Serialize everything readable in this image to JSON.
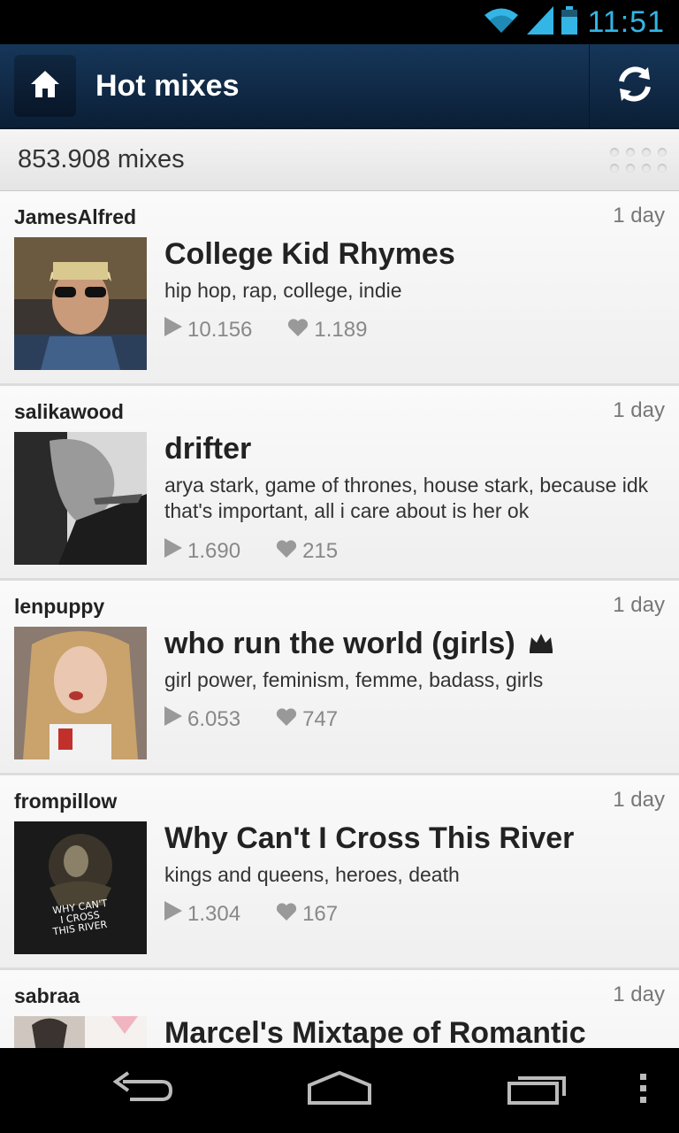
{
  "status_bar": {
    "time": "11:51",
    "icons": [
      "wifi-icon",
      "signal-icon",
      "battery-icon"
    ],
    "accent": "#33b5e5"
  },
  "action_bar": {
    "title": "Hot mixes",
    "home_icon": "home-icon",
    "refresh_icon": "refresh-icon",
    "bg_color": "#163659"
  },
  "count_bar": {
    "count_label": "853.908 mixes"
  },
  "mixes": [
    {
      "user": "JamesAlfred",
      "age": "1 day",
      "title": "College Kid Rhymes",
      "tags": "hip hop, rap, college, indie",
      "plays": "10.156",
      "likes": "1.189",
      "crown": false
    },
    {
      "user": "salikawood",
      "age": "1 day",
      "title": "drifter",
      "tags": "arya stark, game of thrones, house stark, because idk that's important, all i care about is her ok",
      "plays": "1.690",
      "likes": "215",
      "crown": false
    },
    {
      "user": "lenpuppy",
      "age": "1 day",
      "title": "who run the world (girls)",
      "tags": "girl power, feminism, femme, badass, girls",
      "plays": "6.053",
      "likes": "747",
      "crown": true
    },
    {
      "user": "frompillow",
      "age": "1 day",
      "title": "Why Can't I Cross This River",
      "tags": "kings and queens, heroes, death",
      "plays": "1.304",
      "likes": "167",
      "crown": false,
      "cover_text": "WHY CAN'T I CROSS THIS RIVER"
    },
    {
      "user": "sabraa",
      "age": "1 day",
      "title": "Marcel's Mixtape of Romantic",
      "tags": "",
      "plays": "",
      "likes": ""
    }
  ],
  "nav_bar": {
    "icons": [
      "back-icon",
      "home-nav-icon",
      "recent-apps-icon",
      "menu-overflow-icon"
    ]
  }
}
